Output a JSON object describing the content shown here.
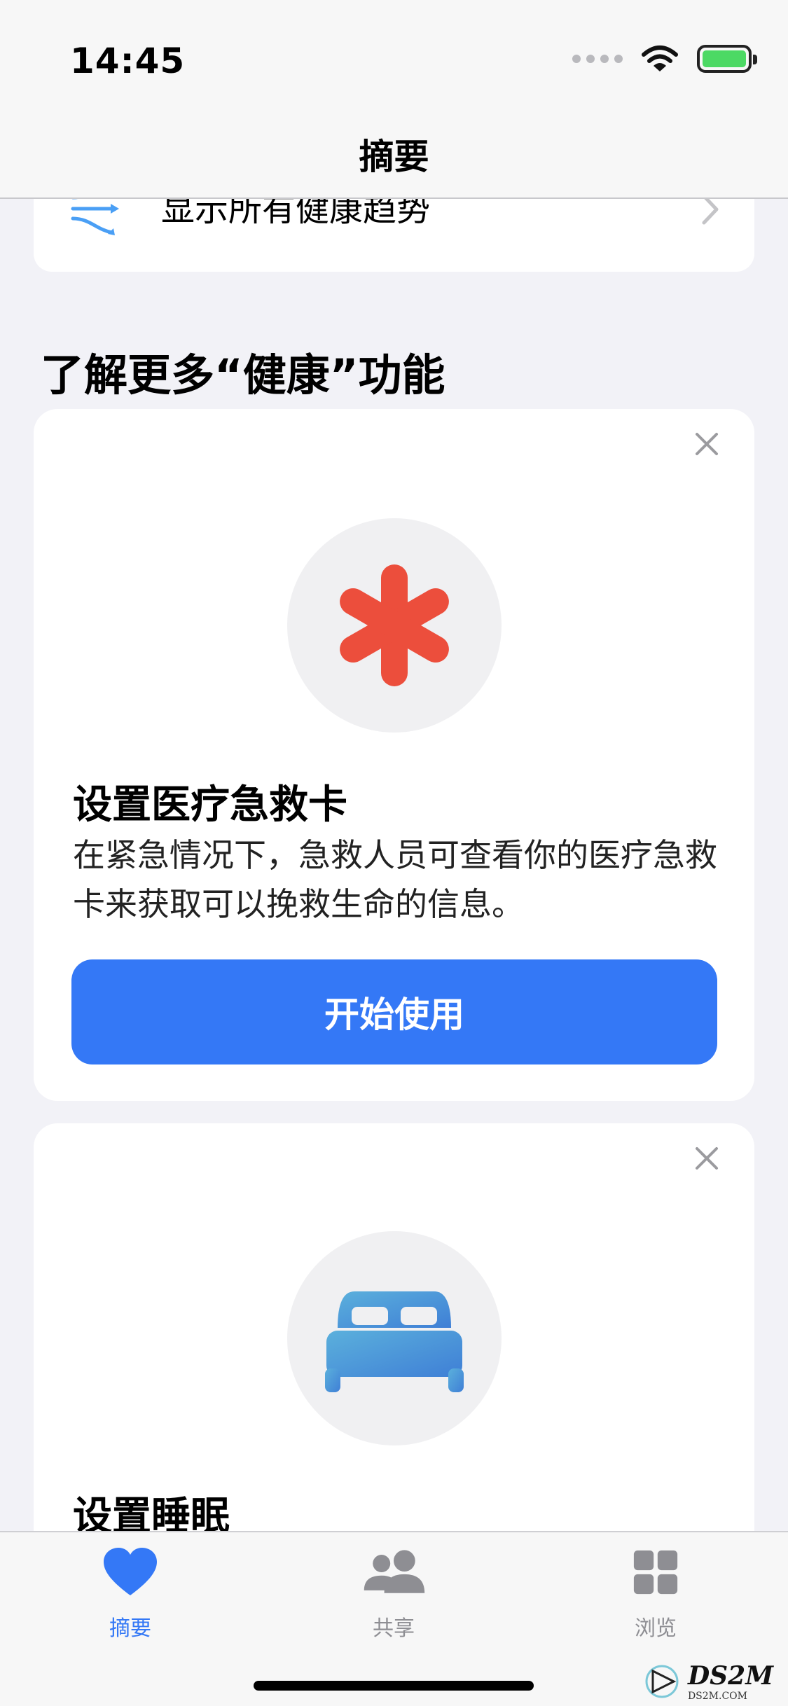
{
  "status_bar": {
    "time": "14:45"
  },
  "nav": {
    "title": "摘要"
  },
  "trends": {
    "label": "显示所有健康趋势"
  },
  "section": {
    "title": "了解更多“健康”功能"
  },
  "cards": [
    {
      "title": "设置医疗急救卡",
      "description": "在紧急情况下，急救人员可查看你的医疗急救卡来获取可以挽救生命的信息。",
      "button": "开始使用",
      "icon": "medical-asterisk-icon"
    },
    {
      "title": "设置睡眠",
      "icon": "bed-icon"
    }
  ],
  "tabbar": {
    "items": [
      {
        "label": "摘要",
        "icon": "heart-icon",
        "active": true
      },
      {
        "label": "共享",
        "icon": "people-icon",
        "active": false
      },
      {
        "label": "浏览",
        "icon": "grid-icon",
        "active": false
      }
    ]
  },
  "watermark": {
    "text": "DS2M",
    "sub": "DS2M.COM"
  },
  "colors": {
    "accent": "#3478f6",
    "asterisk": "#ec4e3c",
    "background": "#f2f2f7",
    "battery": "#4cd964"
  }
}
